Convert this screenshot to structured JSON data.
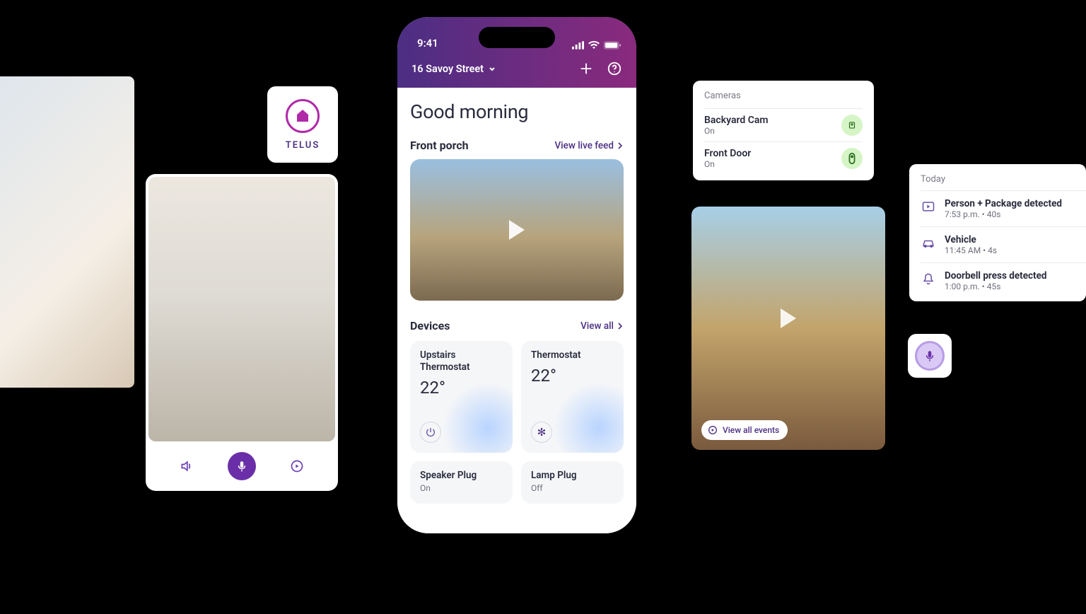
{
  "telus_label": "TELUS",
  "status": {
    "time": "9:41"
  },
  "header": {
    "address": "16 Savoy Street"
  },
  "greeting": "Good morning",
  "front_porch": {
    "title": "Front porch",
    "link": "View live feed"
  },
  "devices_section": {
    "title": "Devices",
    "link": "View all"
  },
  "devices": [
    {
      "name": "Upstairs Thermostat",
      "value": "22°"
    },
    {
      "name": "Thermostat",
      "value": "22°"
    },
    {
      "name": "Speaker Plug",
      "status": "On"
    },
    {
      "name": "Lamp Plug",
      "status": "Off"
    }
  ],
  "cameras": {
    "title": "Cameras",
    "items": [
      {
        "name": "Backyard Cam",
        "status": "On"
      },
      {
        "name": "Front Door",
        "status": "On"
      }
    ]
  },
  "today": {
    "title": "Today",
    "events": [
      {
        "name": "Person + Package detected",
        "sub": "7:53 p.m. • 40s"
      },
      {
        "name": "Vehicle",
        "sub": "11:45 AM • 4s"
      },
      {
        "name": "Doorbell press detected",
        "sub": "1:00 p.m. • 45s"
      }
    ]
  },
  "patio": {
    "view_events": "View all events"
  }
}
